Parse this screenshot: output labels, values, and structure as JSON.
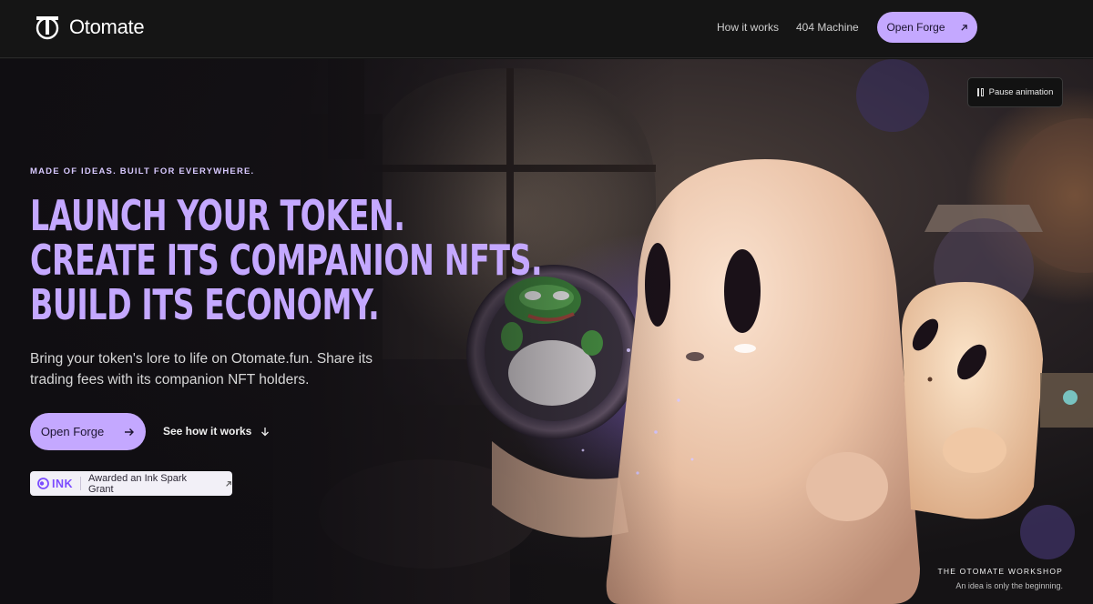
{
  "header": {
    "brand": "Otomate",
    "nav": [
      {
        "label": "How it works"
      },
      {
        "label": "404 Machine"
      }
    ],
    "cta_label": "Open Forge",
    "cta_icon": "arrow-up-right-icon"
  },
  "hero": {
    "pause_label": "Pause animation",
    "eyebrow": "MADE OF IDEAS. BUILT FOR EVERYWHERE.",
    "headline": [
      "LAUNCH YOUR TOKEN.",
      "CREATE ITS COMPANION NFTS.",
      "BUILD ITS ECONOMY."
    ],
    "subtext": "Bring your token's lore to life on Otomate.fun. Share its trading fees with its companion NFT holders.",
    "primary_cta": "Open Forge",
    "secondary_cta": "See how it works",
    "badge_brand": "ink",
    "badge_text": "Awarded an Ink Spark Grant",
    "caption_title": "THE OTOMATE WORKSHOP",
    "caption_sub": "An idea is only the beginning."
  },
  "colors": {
    "accent": "#c4a8ff",
    "header_bg": "#151515",
    "ink_brand": "#7b4cff"
  }
}
